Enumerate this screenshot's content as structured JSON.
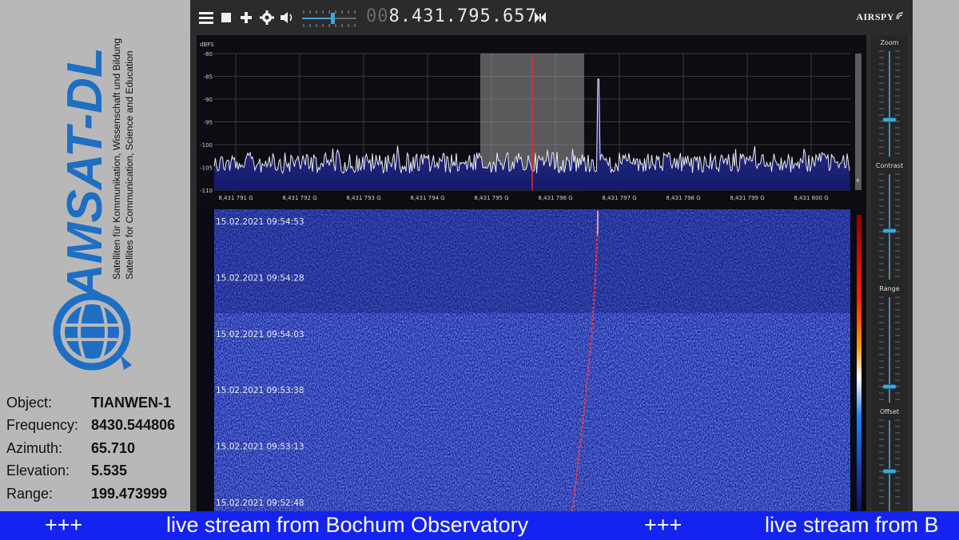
{
  "logo": {
    "brand": "AMSAT-DL",
    "tagline_de": "Satelliten für Kommunikation, Wissenschaft und Bildung",
    "tagline_en": "Satellites for Communication, Science and Education"
  },
  "info": [
    {
      "label": "Object:",
      "value": "TIANWEN-1"
    },
    {
      "label": "Frequency:",
      "value": "8430.544806"
    },
    {
      "label": "Azimuth:",
      "value": "65.710"
    },
    {
      "label": "Elevation:",
      "value": "5.535"
    },
    {
      "label": "Range:",
      "value": "199.473999"
    }
  ],
  "toolbar": {
    "menu_icon": "menu-icon",
    "stop_icon": "stop-icon",
    "add_icon": "plus-icon",
    "settings_icon": "gear-icon",
    "volume_icon": "speaker-icon",
    "frequency_prefix": "00",
    "frequency_main": "8.431.795.657",
    "bandwidth_icon": "bowtie-icon",
    "brand": "AIRSPY"
  },
  "spectrum": {
    "unit": "dBFS",
    "y_ticks": [
      "-80",
      "-85",
      "-90",
      "-95",
      "-100",
      "-105",
      "-110"
    ],
    "x_ticks": [
      "8,431 791 G",
      "8,431 792 G",
      "8,431 793 G",
      "8,431 794 G",
      "8,431 795 G",
      "8,431 796 G",
      "8,431 797 G",
      "8,431 798 G",
      "8,431 799 G",
      "8,431 800 G"
    ],
    "scroll_label": "4"
  },
  "waterfall": {
    "timestamps": [
      "15.02.2021 09:54:53",
      "15.02.2021 09:54:28",
      "15.02.2021 09:54:03",
      "15.02.2021 09:53:38",
      "15.02.2021 09:53:13",
      "15.02.2021 09:52:48"
    ]
  },
  "controls": {
    "zoom": "Zoom",
    "contrast": "Contrast",
    "range": "Range",
    "offset": "Offset"
  },
  "ticker": {
    "items": [
      "+++",
      "live stream from Bochum Observatory",
      "+++",
      "live stream from B"
    ]
  },
  "colors": {
    "ticker_bg": "#1523f0",
    "waterfall_bg": "#1a2aa0",
    "trace": "#e8e8f0",
    "tuning_line": "#e03030",
    "logo_blue": "#1e6fc4"
  }
}
